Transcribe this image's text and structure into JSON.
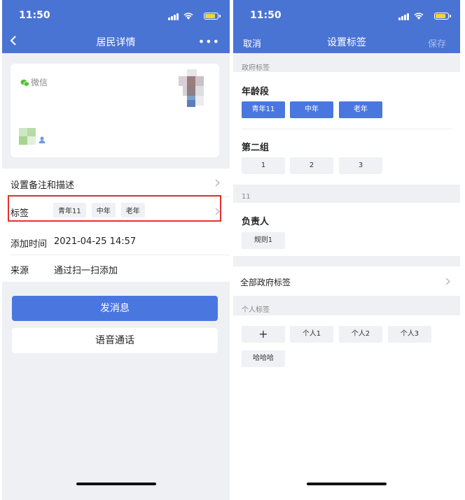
{
  "status": {
    "time": "11:50"
  },
  "left": {
    "nav_title": "居民详情",
    "more": "•••",
    "profile": {
      "source_app": "微信"
    },
    "rows": {
      "remark": {
        "label": "设置备注和描述"
      },
      "tags": {
        "label": "标签",
        "tags": [
          "青年11",
          "中年",
          "老年"
        ]
      },
      "added": {
        "label": "添加时间",
        "value": "2021-04-25 14:57"
      },
      "source": {
        "label": "来源",
        "value": "通过扫一扫添加"
      }
    },
    "buttons": {
      "message": "发消息",
      "voice": "语音通话"
    }
  },
  "right": {
    "nav": {
      "cancel": "取消",
      "title": "设置标签",
      "save": "保存"
    },
    "gov_section_label": "政府标签",
    "age_group": {
      "title": "年龄段",
      "options": [
        "青年11",
        "中年",
        "老年"
      ],
      "selected": "青年11"
    },
    "group2": {
      "title": "第二组",
      "options": [
        "1",
        "2",
        "3"
      ]
    },
    "section_11_label": "11",
    "owner": {
      "title": "负责人",
      "options": [
        "规则1"
      ]
    },
    "all_gov_tags": "全部政府标签",
    "personal_section_label": "个人标签",
    "personal": {
      "add": "+",
      "options": [
        "个人1",
        "个人2",
        "个人3",
        "哈哈哈"
      ]
    }
  },
  "colors": {
    "accent": "#4a74d4",
    "highlight": "#e5322f"
  }
}
